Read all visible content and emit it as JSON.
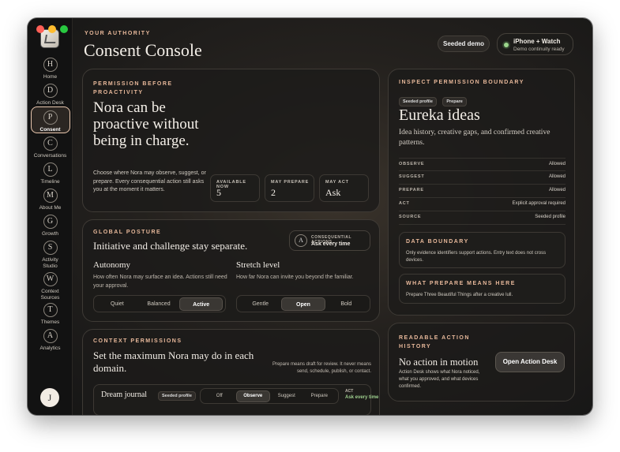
{
  "window": {
    "traffic_colors": [
      "#ff5f57",
      "#febc2e",
      "#28c840"
    ]
  },
  "sidebar": {
    "items": [
      {
        "letter": "H",
        "label": "Home"
      },
      {
        "letter": "D",
        "label": "Action Desk"
      },
      {
        "letter": "P",
        "label": "Consent"
      },
      {
        "letter": "C",
        "label": "Conversations"
      },
      {
        "letter": "L",
        "label": "Timeline"
      },
      {
        "letter": "M",
        "label": "About Me"
      },
      {
        "letter": "G",
        "label": "Growth"
      },
      {
        "letter": "S",
        "label": "Activity Studio"
      },
      {
        "letter": "W",
        "label": "Context Sources"
      },
      {
        "letter": "T",
        "label": "Themes"
      },
      {
        "letter": "A",
        "label": "Analytics"
      }
    ],
    "active_index": 2,
    "avatar": "J"
  },
  "header": {
    "eyebrow": "YOUR AUTHORITY",
    "title": "Consent Console",
    "seeded_label": "Seeded demo",
    "device_title": "iPhone + Watch",
    "device_sub": "Demo continuity ready"
  },
  "hero": {
    "eyebrow": "PERMISSION BEFORE PROACTIVITY",
    "headline": "Nora can be proactive without being in charge.",
    "body": "Choose where Nora may observe, suggest, or prepare. Every consequential action still asks you at the moment it matters.",
    "tiles": [
      {
        "label": "AVAILABLE NOW",
        "value": "5"
      },
      {
        "label": "MAY PREPARE",
        "value": "2"
      },
      {
        "label": "MAY ACT",
        "value": "Ask"
      }
    ]
  },
  "posture": {
    "eyebrow": "GLOBAL POSTURE",
    "headline": "Initiative and challenge stay separate.",
    "badge_letter": "A",
    "badge_label": "CONSEQUENTIAL ACTIONS",
    "badge_value": "Ask every time",
    "autonomy": {
      "title": "Autonomy",
      "desc": "How often Nora may surface an idea. Actions still need your approval.",
      "options": [
        "Quiet",
        "Balanced",
        "Active"
      ],
      "selected": "Active"
    },
    "stretch": {
      "title": "Stretch level",
      "desc": "How far Nora can invite you beyond the familiar.",
      "options": [
        "Gentle",
        "Open",
        "Bold"
      ],
      "selected": "Open"
    }
  },
  "context": {
    "eyebrow": "CONTEXT PERMISSIONS",
    "headline": "Set the maximum Nora may do in each domain.",
    "note": "Prepare means draft for review. It never means send, schedule, publish, or contact.",
    "row": {
      "name": "Dream journal",
      "tag": "Seeded profile",
      "options": [
        "Off",
        "Observe",
        "Suggest",
        "Prepare"
      ],
      "selected": "Observe",
      "act_label": "ACT",
      "act_value": "Ask every time"
    }
  },
  "inspect": {
    "eyebrow": "INSPECT PERMISSION BOUNDARY",
    "chips": [
      "Seeded profile",
      "Prepare"
    ],
    "title": "Eureka ideas",
    "desc": "Idea history, creative gaps, and confirmed creative patterns.",
    "rows": [
      {
        "key": "OBSERVE",
        "value": "Allowed"
      },
      {
        "key": "SUGGEST",
        "value": "Allowed"
      },
      {
        "key": "PREPARE",
        "value": "Allowed"
      },
      {
        "key": "ACT",
        "value": "Explicit approval required"
      },
      {
        "key": "SOURCE",
        "value": "Seeded profile"
      }
    ],
    "data_boundary": {
      "title": "DATA BOUNDARY",
      "text": "Only evidence identifiers support actions. Entry text does not cross devices."
    },
    "prepare_here": {
      "title": "WHAT PREPARE MEANS HERE",
      "text": "Prepare Three Beautiful Things after a creative lull."
    }
  },
  "history": {
    "eyebrow": "READABLE ACTION HISTORY",
    "title": "No action in motion",
    "desc": "Action Desk shows what Nora noticed, what you approved, and what devices confirmed.",
    "button": "Open Action Desk"
  }
}
